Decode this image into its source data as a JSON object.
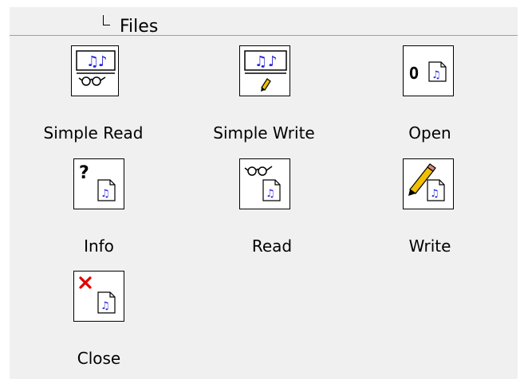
{
  "header": {
    "title": "Files"
  },
  "tools": [
    {
      "id": "simple-read",
      "label": "Simple Read"
    },
    {
      "id": "simple-write",
      "label": "Simple Write"
    },
    {
      "id": "open",
      "label": "Open"
    },
    {
      "id": "info",
      "label": "Info"
    },
    {
      "id": "read",
      "label": "Read"
    },
    {
      "id": "write",
      "label": "Write"
    },
    {
      "id": "close",
      "label": "Close"
    }
  ],
  "icons": {
    "simple-read": "music-file-glasses-icon",
    "simple-write": "music-file-pencil-icon",
    "open": "open-file-icon",
    "info": "info-file-icon",
    "read": "read-glasses-file-icon",
    "write": "write-pencil-file-icon",
    "close": "close-x-file-icon"
  },
  "colors": {
    "panel_bg": "#f0f0f0",
    "icon_blue": "#2121d6",
    "close_red": "#e00000",
    "pencil_yellow": "#f0c000"
  }
}
